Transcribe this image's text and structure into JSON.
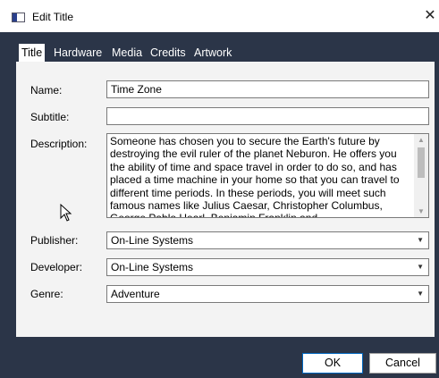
{
  "window": {
    "title": "Edit Title",
    "close_icon": "close-icon"
  },
  "tabs": [
    {
      "label": "Title",
      "active": true
    },
    {
      "label": "Hardware",
      "active": false
    },
    {
      "label": "Media",
      "active": false
    },
    {
      "label": "Credits",
      "active": false
    },
    {
      "label": "Artwork",
      "active": false
    }
  ],
  "form": {
    "name_label": "Name:",
    "name_value": "Time Zone",
    "subtitle_label": "Subtitle:",
    "subtitle_value": "",
    "description_label": "Description:",
    "description_value": "Someone has chosen you to secure the Earth's future by destroying the evil ruler of the planet Neburon. He offers you the ability of time and space travel in order to do so, and has placed a time machine in your home so that you can travel to different time periods. In these periods, you will meet such famous names like Julius Caesar, Christopher Columbus, George Pablo Hearl, Benjamin Franklin and",
    "publisher_label": "Publisher:",
    "publisher_value": "On-Line Systems",
    "developer_label": "Developer:",
    "developer_value": "On-Line Systems",
    "genre_label": "Genre:",
    "genre_value": "Adventure"
  },
  "buttons": {
    "ok": "OK",
    "cancel": "Cancel"
  },
  "colors": {
    "frame": "#2b3548",
    "panel": "#f3f3f3",
    "accent": "#0067c0"
  }
}
